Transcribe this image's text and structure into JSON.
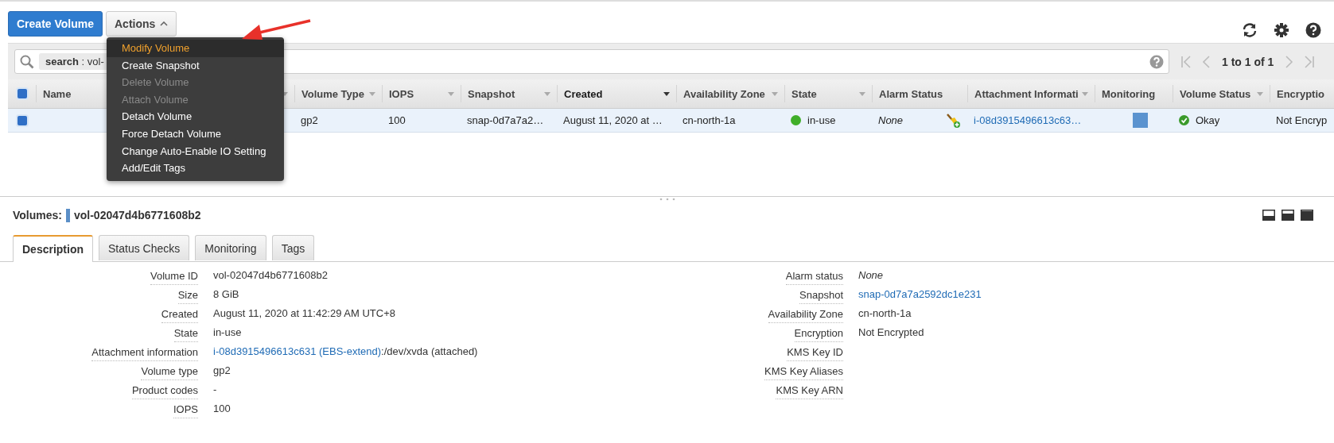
{
  "toolbar": {
    "create_button": "Create Volume",
    "actions_button": "Actions"
  },
  "actions_menu": [
    {
      "label": "Modify Volume",
      "disabled": false,
      "selected": true
    },
    {
      "label": "Create Snapshot",
      "disabled": false,
      "selected": false
    },
    {
      "label": "Delete Volume",
      "disabled": true,
      "selected": false
    },
    {
      "label": "Attach Volume",
      "disabled": true,
      "selected": false
    },
    {
      "label": "Detach Volume",
      "disabled": false,
      "selected": false
    },
    {
      "label": "Force Detach Volume",
      "disabled": false,
      "selected": false
    },
    {
      "label": "Change Auto-Enable IO Setting",
      "disabled": false,
      "selected": false
    },
    {
      "label": "Add/Edit Tags",
      "disabled": false,
      "selected": false
    }
  ],
  "search": {
    "token": "**search** : vol-"
  },
  "pager": {
    "text": "1 to 1 of 1"
  },
  "table": {
    "select_all_checked": true,
    "columns": [
      {
        "label": "Name",
        "sortable": true,
        "sorted": false
      },
      {
        "label": "Volume Type",
        "sortable": true,
        "sorted": false
      },
      {
        "label": "IOPS",
        "sortable": true,
        "sorted": false
      },
      {
        "label": "Snapshot",
        "sortable": true,
        "sorted": false
      },
      {
        "label": "Created",
        "sortable": true,
        "sorted": true
      },
      {
        "label": "Availability Zone",
        "sortable": true,
        "sorted": false
      },
      {
        "label": "State",
        "sortable": true,
        "sorted": false
      },
      {
        "label": "Alarm Status",
        "sortable": false,
        "sorted": false
      },
      {
        "label": "Attachment Informati",
        "sortable": true,
        "sorted": false
      },
      {
        "label": "Monitoring",
        "sortable": false,
        "sorted": false
      },
      {
        "label": "Volume Status",
        "sortable": true,
        "sorted": false
      },
      {
        "label": "Encryptio",
        "sorted": false
      }
    ],
    "rows": [
      {
        "selected": true,
        "cells": [
          {
            "kind": "empty"
          },
          {
            "kind": "text",
            "text": "gp2"
          },
          {
            "kind": "text",
            "text": "100"
          },
          {
            "kind": "text",
            "text": "snap-0d7a7a2…"
          },
          {
            "kind": "text",
            "text": "August 11, 2020 at …"
          },
          {
            "kind": "text",
            "text": "cn-north-1a"
          },
          {
            "kind": "state",
            "text": "in-use",
            "color": "#3fae29"
          },
          {
            "kind": "alarm",
            "text": "None"
          },
          {
            "kind": "link",
            "text": "i-08d3915496613c63…"
          },
          {
            "kind": "monitor"
          },
          {
            "kind": "status",
            "text": "Okay"
          },
          {
            "kind": "text",
            "text": "Not Encryp"
          }
        ]
      }
    ]
  },
  "details": {
    "label": "Volumes:",
    "volume_id": "vol-02047d4b6771608b2",
    "tabs": [
      {
        "label": "Description",
        "selected": true
      },
      {
        "label": "Status Checks",
        "selected": false
      },
      {
        "label": "Monitoring",
        "selected": false
      },
      {
        "label": "Tags",
        "selected": false
      }
    ],
    "left": [
      {
        "label": "Volume ID",
        "kind": "text",
        "value": "vol-02047d4b6771608b2"
      },
      {
        "label": "Size",
        "kind": "text",
        "value": "8 GiB"
      },
      {
        "label": "Created",
        "kind": "text",
        "value": "August 11, 2020 at 11:42:29 AM UTC+8"
      },
      {
        "label": "State",
        "kind": "text",
        "value": "in-use"
      },
      {
        "label": "Attachment information",
        "kind": "attachment",
        "link": "i-08d3915496613c631 (EBS-extend)",
        "value": ":/dev/xvda (attached)"
      },
      {
        "label": "Volume type",
        "kind": "text",
        "value": "gp2"
      },
      {
        "label": "Product codes",
        "kind": "text",
        "value": "-"
      },
      {
        "label": "IOPS",
        "kind": "text",
        "value": "100"
      }
    ],
    "right": [
      {
        "label": "Alarm status",
        "kind": "italic",
        "value": "None"
      },
      {
        "label": "Snapshot",
        "kind": "link",
        "value": "snap-0d7a7a2592dc1e231"
      },
      {
        "label": "Availability Zone",
        "kind": "text",
        "value": "cn-north-1a"
      },
      {
        "label": "Encryption",
        "kind": "text",
        "value": "Not Encrypted"
      },
      {
        "label": "KMS Key ID",
        "kind": "empty"
      },
      {
        "label": "KMS Key Aliases",
        "kind": "empty"
      },
      {
        "label": "KMS Key ARN",
        "kind": "empty"
      }
    ]
  }
}
